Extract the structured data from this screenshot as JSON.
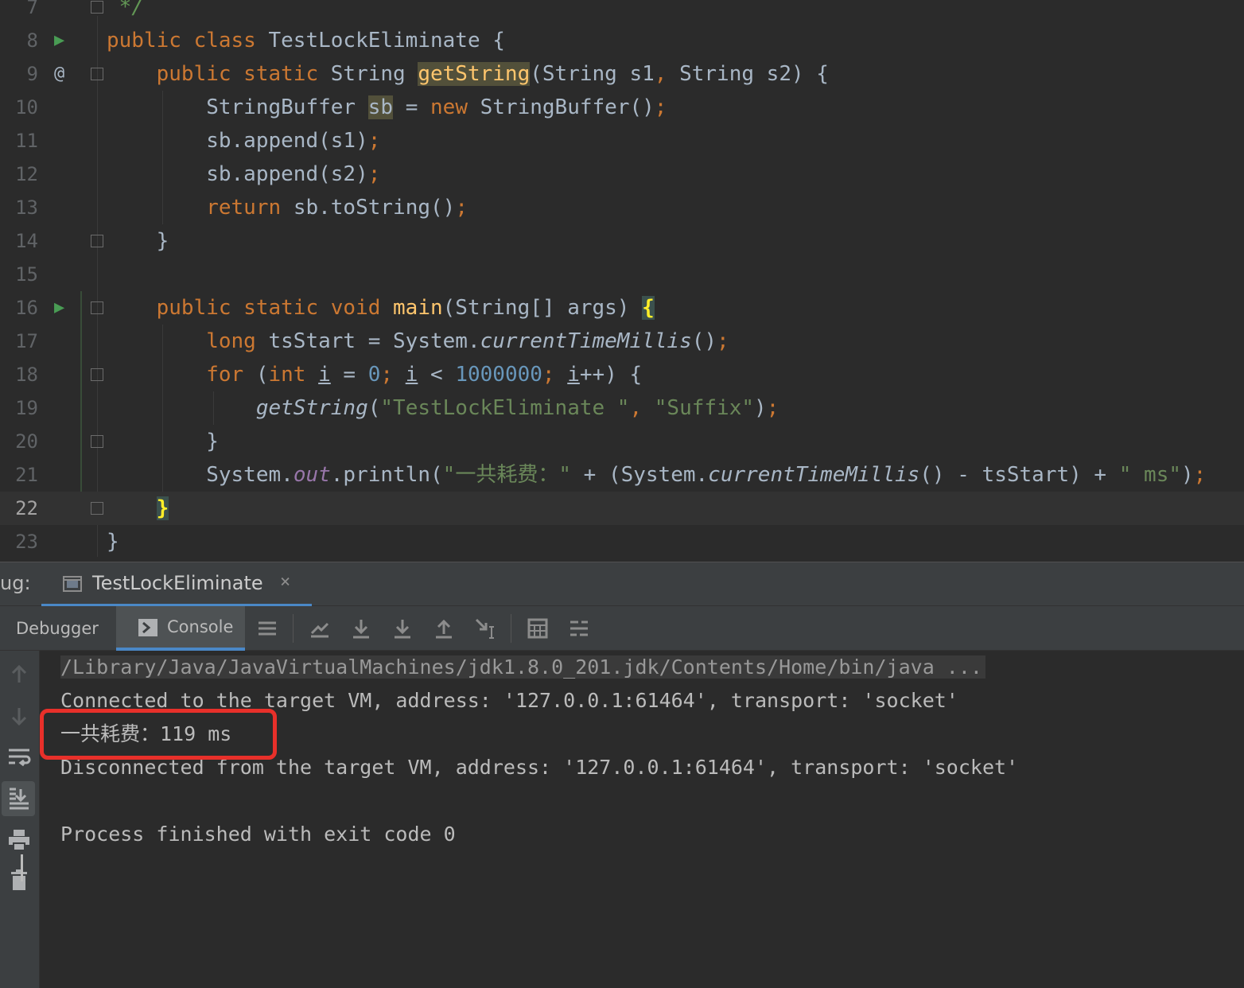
{
  "editor": {
    "lines": [
      {
        "num": "7",
        "segments": [
          {
            "t": " */",
            "c": "cm"
          }
        ]
      },
      {
        "num": "8",
        "segments": [
          {
            "t": "public class ",
            "c": "kw"
          },
          {
            "t": "TestLockEliminate {",
            "c": ""
          }
        ]
      },
      {
        "num": "9",
        "segments": [
          {
            "t": "    public static ",
            "c": "kw"
          },
          {
            "t": "String ",
            "c": ""
          },
          {
            "t": "getString",
            "c": "fn hl"
          },
          {
            "t": "(String s1",
            "c": ""
          },
          {
            "t": ", ",
            "c": "kw"
          },
          {
            "t": "String s2) {",
            "c": ""
          }
        ]
      },
      {
        "num": "10",
        "segments": [
          {
            "t": "        StringBuffer ",
            "c": ""
          },
          {
            "t": "sb",
            "c": "hl"
          },
          {
            "t": " = ",
            "c": ""
          },
          {
            "t": "new ",
            "c": "kw"
          },
          {
            "t": "StringBuffer()",
            "c": ""
          },
          {
            "t": ";",
            "c": "kw"
          }
        ]
      },
      {
        "num": "11",
        "segments": [
          {
            "t": "        sb.append(s1)",
            "c": ""
          },
          {
            "t": ";",
            "c": "kw"
          }
        ]
      },
      {
        "num": "12",
        "segments": [
          {
            "t": "        sb.append(s2)",
            "c": ""
          },
          {
            "t": ";",
            "c": "kw"
          }
        ]
      },
      {
        "num": "13",
        "segments": [
          {
            "t": "        return ",
            "c": "kw"
          },
          {
            "t": "sb.toString()",
            "c": ""
          },
          {
            "t": ";",
            "c": "kw"
          }
        ]
      },
      {
        "num": "14",
        "segments": [
          {
            "t": "    }",
            "c": ""
          }
        ]
      },
      {
        "num": "15",
        "segments": []
      },
      {
        "num": "16",
        "segments": [
          {
            "t": "    public static void ",
            "c": "kw"
          },
          {
            "t": "main",
            "c": "fn"
          },
          {
            "t": "(String[] args) ",
            "c": ""
          },
          {
            "t": "{",
            "c": "brace"
          }
        ]
      },
      {
        "num": "17",
        "segments": [
          {
            "t": "        long ",
            "c": "kw"
          },
          {
            "t": "tsStart = System.",
            "c": ""
          },
          {
            "t": "currentTimeMillis",
            "c": "it"
          },
          {
            "t": "()",
            "c": ""
          },
          {
            "t": ";",
            "c": "kw"
          }
        ]
      },
      {
        "num": "18",
        "segments": [
          {
            "t": "        for ",
            "c": "kw"
          },
          {
            "t": "(",
            "c": ""
          },
          {
            "t": "int ",
            "c": "kw"
          },
          {
            "t": "i",
            "c": "ul"
          },
          {
            "t": " = ",
            "c": ""
          },
          {
            "t": "0",
            "c": "num"
          },
          {
            "t": "; ",
            "c": "kw"
          },
          {
            "t": "i",
            "c": "ul"
          },
          {
            "t": " < ",
            "c": ""
          },
          {
            "t": "1000000",
            "c": "num"
          },
          {
            "t": "; ",
            "c": "kw"
          },
          {
            "t": "i",
            "c": "ul"
          },
          {
            "t": "++) {",
            "c": ""
          }
        ]
      },
      {
        "num": "19",
        "segments": [
          {
            "t": "            ",
            "c": ""
          },
          {
            "t": "getString",
            "c": "it"
          },
          {
            "t": "(",
            "c": ""
          },
          {
            "t": "\"TestLockEliminate \"",
            "c": "str"
          },
          {
            "t": ", ",
            "c": "kw"
          },
          {
            "t": "\"Suffix\"",
            "c": "str"
          },
          {
            "t": ")",
            "c": ""
          },
          {
            "t": ";",
            "c": "kw"
          }
        ]
      },
      {
        "num": "20",
        "segments": [
          {
            "t": "        }",
            "c": ""
          }
        ]
      },
      {
        "num": "21",
        "segments": [
          {
            "t": "        System.",
            "c": ""
          },
          {
            "t": "out",
            "c": "field"
          },
          {
            "t": ".println(",
            "c": ""
          },
          {
            "t": "\"一共耗费：\"",
            "c": "str"
          },
          {
            "t": " + (System.",
            "c": ""
          },
          {
            "t": "currentTimeMillis",
            "c": "it"
          },
          {
            "t": "() - tsStart) + ",
            "c": ""
          },
          {
            "t": "\" ms\"",
            "c": "str"
          },
          {
            "t": ")",
            "c": ""
          },
          {
            "t": ";",
            "c": "kw"
          }
        ]
      },
      {
        "num": "22",
        "segments": [
          {
            "t": "    ",
            "c": ""
          },
          {
            "t": "}",
            "c": "brace"
          }
        ]
      },
      {
        "num": "23",
        "segments": [
          {
            "t": "}",
            "c": ""
          }
        ]
      }
    ]
  },
  "debug_panel": {
    "title": "ug:",
    "session_tab": "TestLockEliminate",
    "close_glyph": "×",
    "tabs": {
      "debugger": "Debugger",
      "console": "Console"
    }
  },
  "console": {
    "command_line": "/Library/Java/JavaVirtualMachines/jdk1.8.0_201.jdk/Contents/Home/bin/java ...",
    "connected": "Connected to the target VM, address: '127.0.0.1:61464', transport: 'socket'",
    "elapsed": "一共耗费：119 ms",
    "disconnected": "Disconnected from the target VM, address: '127.0.0.1:61464', transport: 'socket'",
    "exit": "Process finished with exit code 0"
  },
  "colors": {
    "accent": "#4a88c7",
    "highlight_box": "#e8302a",
    "keyword": "#cc7832",
    "string": "#6a8759"
  }
}
